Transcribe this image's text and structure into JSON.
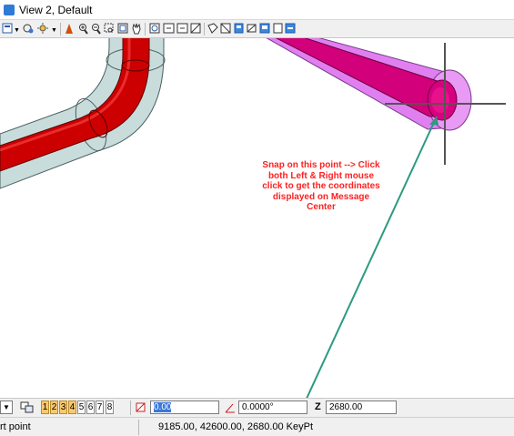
{
  "window": {
    "title": "View 2, Default"
  },
  "toolbar": {
    "icons": [
      "view-attributes-icon",
      "display-style-icon",
      "lighting-icon",
      "update-view-icon",
      "zoom-in-icon",
      "zoom-out-icon",
      "window-area-icon",
      "fit-view-icon",
      "pan-view-icon",
      "rotate-view-icon",
      "view-previous-icon",
      "view-next-icon",
      "clip-volume-icon",
      "render-icon",
      "standard-views-icon",
      "camera-icon",
      "save-view-icon",
      "walk-icon"
    ]
  },
  "annotation": {
    "lines": [
      "Snap on this point --> Click",
      "both Left & Right mouse",
      "click to get the coordinates",
      "displayed on Message",
      "Center"
    ],
    "color": "#ff2020",
    "arrow_color": "#2a9a80"
  },
  "bottombar": {
    "view_buttons": [
      "1",
      "2",
      "3",
      "4",
      "5",
      "6",
      "7",
      "8"
    ],
    "active_views": [
      "1",
      "2",
      "3",
      "4"
    ],
    "distance_value": "0.00",
    "angle_value": "0.0000°",
    "z_label": "Z",
    "z_value": "2680.00"
  },
  "status": {
    "prompt": "rt point",
    "coordinates": "9185.00, 42600.00, 2680.00 KeyPt"
  },
  "colors": {
    "pipe_red": "#cc0000",
    "pipe_magenta": "#d2007a",
    "insulation_grey": "#c9dcdc",
    "insulation_violet": "#e080f0"
  }
}
